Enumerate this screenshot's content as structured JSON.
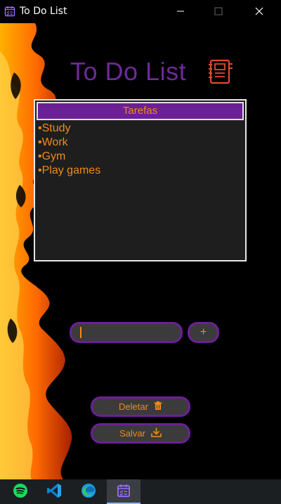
{
  "window": {
    "title": "To Do List",
    "icons": {
      "app": "todo-calendar-icon",
      "minimize": "minimize-icon",
      "maximize": "maximize-icon",
      "close": "close-icon"
    }
  },
  "app": {
    "title": "To Do List",
    "title_icon": "notebook-icon",
    "list_header": "Tarefas",
    "tasks": [
      "•Study",
      "•Work",
      "•Gym",
      "•Play games"
    ],
    "input_value": "",
    "add_label": "+",
    "delete_label": "Deletar",
    "delete_icon": "trash-icon",
    "save_label": "Salvar",
    "save_icon": "download-icon"
  },
  "taskbar": {
    "items": [
      "spotify-icon",
      "vscode-icon",
      "edge-icon",
      "todo-app-icon"
    ]
  },
  "colors": {
    "accent_purple": "#6b2096",
    "text_orange": "#f08a1a",
    "button_bg": "#3b3b3b",
    "list_bg": "#1e1e1e"
  }
}
